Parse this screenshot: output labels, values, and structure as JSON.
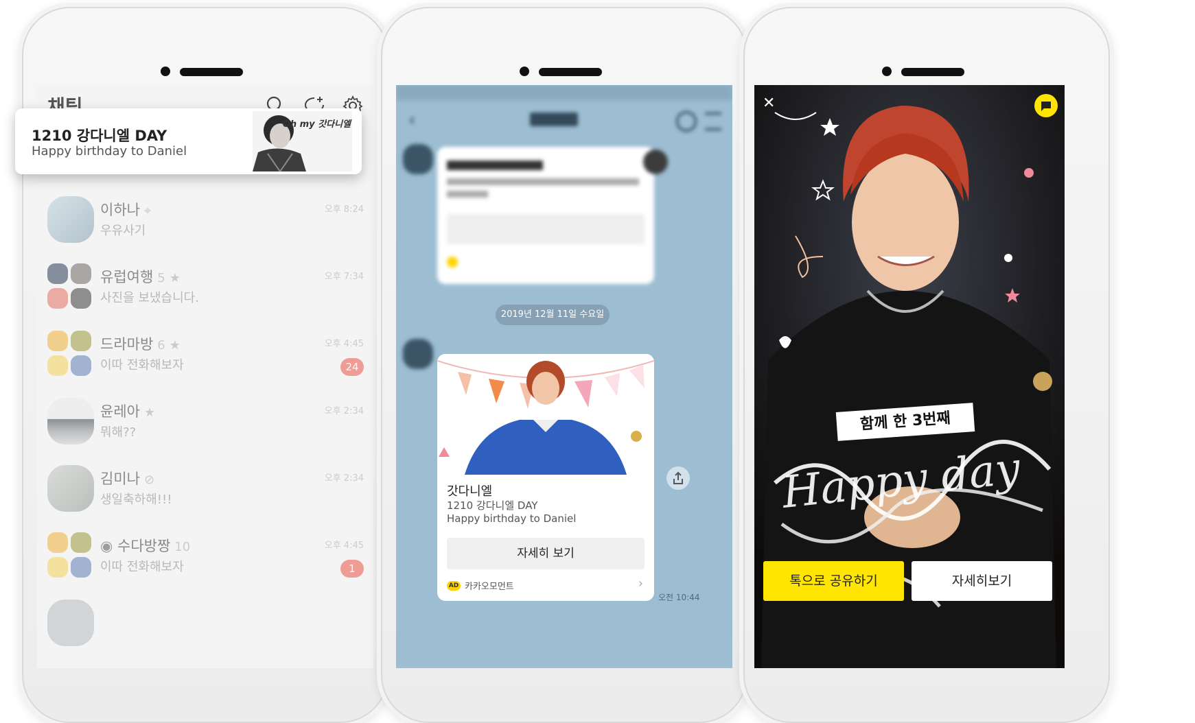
{
  "phone1": {
    "header_title": "채팅",
    "highlight": {
      "title": "1210 강다니엘 DAY",
      "subtitle": "Happy birthday to Daniel",
      "image_caption": "Oh my 갓다니엘"
    },
    "rows": [
      {
        "name": "이하나",
        "count": "",
        "message": "우유사기",
        "time": "오후 8:24",
        "badge": ""
      },
      {
        "name": "유럽여행",
        "count": "5",
        "message": "사진을 보냈습니다.",
        "time": "오후 7:34",
        "badge": ""
      },
      {
        "name": "드라마방",
        "count": "6",
        "message": "이따 전화해보자",
        "time": "오후 4:45",
        "badge": "24"
      },
      {
        "name": "윤레아",
        "count": "",
        "message": "뭐해??",
        "time": "오후 2:34",
        "badge": ""
      },
      {
        "name": "김미나",
        "count": "",
        "message": "생일축하해!!!",
        "time": "오후 2:34",
        "badge": ""
      },
      {
        "name": "수다방짱",
        "count": "10",
        "message": "이따 전화해보자",
        "time": "오후 4:45",
        "badge": "1"
      }
    ]
  },
  "phone2": {
    "date_pill": "2019년 12월 11일 수요일",
    "card": {
      "title": "갓다니엘",
      "line1": "1210 강다니엘 DAY",
      "line2": "Happy birthday to Daniel",
      "button": "자세히 보기",
      "ad_tag": "AD",
      "brand": "카카오모먼트",
      "chevron": "›"
    },
    "time": "오전 10:44"
  },
  "phone3": {
    "banner_text": "함께 한 3번째",
    "script_text": "Happy day",
    "share_button": "톡으로 공유하기",
    "detail_button": "자세히보기",
    "close_glyph": "✕"
  },
  "colors": {
    "kakao_yellow": "#ffe500",
    "chat_bg": "#9cbdd2",
    "badge_red": "#e8574a"
  }
}
